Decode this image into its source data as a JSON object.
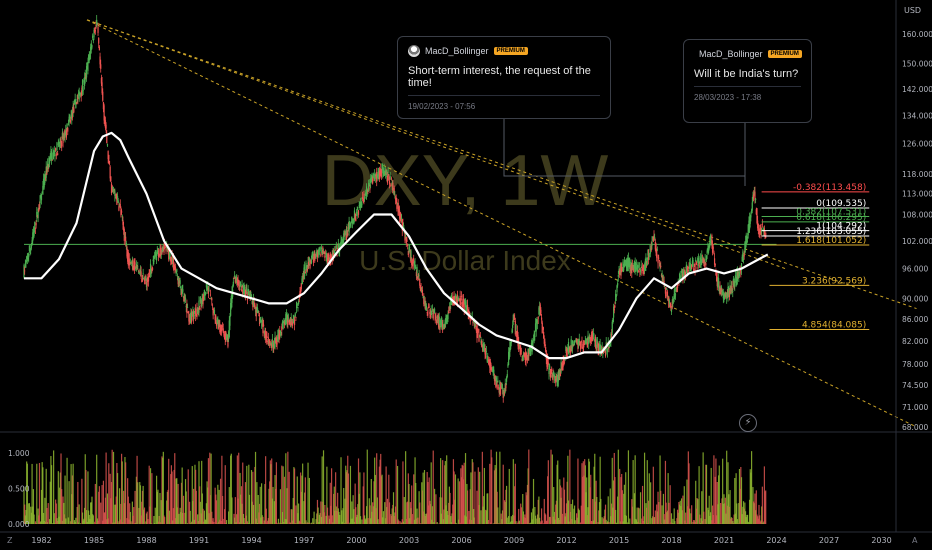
{
  "chart": {
    "watermark_title": "DXY, 1W",
    "watermark_subtitle": "U.S. Dollar Index",
    "currency_label": "USD",
    "timezone_button": "Z",
    "auto_button": "A",
    "colors": {
      "background": "#000000",
      "up": "#4caf50",
      "down": "#ef5350",
      "moving_average": "#ffffff",
      "trendline": "#c9a227",
      "fib_positive": "#ffffff",
      "fib_negative": "#ff4d4d",
      "fib_extension": "#e0b030",
      "accent_badge": "#f5a623"
    }
  },
  "annotations": [
    {
      "user": "MacD_Bollinger",
      "badge": "PREMIUM",
      "message": "Short-term interest, the request of the time!",
      "timestamp": "19/02/2023 - 07:56"
    },
    {
      "user": "MacD_Bollinger",
      "badge": "PREMIUM",
      "message": "Will it be India's turn?",
      "timestamp": "28/03/2023 - 17:38"
    }
  ],
  "chart_data": [
    {
      "type": "candlestick",
      "title": "DXY, 1W",
      "subtitle": "U.S. Dollar Index",
      "y_unit": "USD",
      "ylim": [
        66,
        166
      ],
      "xlim": [
        1981,
        2032
      ],
      "grid": false,
      "x_ticks": [
        "1982",
        "1985",
        "1988",
        "1991",
        "1994",
        "1997",
        "2000",
        "2003",
        "2006",
        "2009",
        "2012",
        "2015",
        "2018",
        "2021",
        "2024",
        "2027",
        "2030"
      ],
      "y_ticks": [
        "160.000",
        "150.000",
        "142.000",
        "134.000",
        "126.000",
        "118.000",
        "113.000",
        "108.000",
        "102.000",
        "96.000",
        "90.000",
        "86.000",
        "82.000",
        "78.000",
        "74.500",
        "71.000",
        "68.000"
      ],
      "price_path": {
        "x": [
          1981.0,
          1981.5,
          1982.0,
          1982.5,
          1983.0,
          1983.5,
          1984.0,
          1984.5,
          1985.0,
          1985.2,
          1985.5,
          1986.0,
          1986.5,
          1987.0,
          1987.5,
          1988.0,
          1988.5,
          1989.0,
          1989.5,
          1990.0,
          1990.5,
          1991.0,
          1991.5,
          1992.0,
          1992.7,
          1993.0,
          1993.5,
          1994.0,
          1994.5,
          1995.0,
          1995.3,
          1996.0,
          1996.5,
          1997.0,
          1997.5,
          1998.0,
          1998.5,
          1999.0,
          1999.5,
          2000.0,
          2000.5,
          2001.0,
          2001.5,
          2002.0,
          2002.5,
          2003.0,
          2003.5,
          2004.0,
          2004.5,
          2005.0,
          2005.5,
          2006.0,
          2006.5,
          2007.0,
          2007.5,
          2008.0,
          2008.5,
          2009.0,
          2009.5,
          2010.0,
          2010.5,
          2011.0,
          2011.5,
          2012.0,
          2012.5,
          2013.0,
          2013.5,
          2014.0,
          2014.5,
          2015.0,
          2015.5,
          2016.0,
          2016.5,
          2017.0,
          2017.5,
          2018.0,
          2018.5,
          2019.0,
          2019.5,
          2020.0,
          2020.3,
          2020.6,
          2021.0,
          2021.5,
          2022.0,
          2022.5,
          2022.75,
          2023.0,
          2023.2,
          2023.4
        ],
        "y": [
          95,
          102,
          112,
          122,
          125,
          130,
          138,
          144,
          160,
          164,
          140,
          115,
          110,
          98,
          96,
          93,
          98,
          101,
          98,
          92,
          86,
          88,
          92,
          86,
          82,
          94,
          92,
          90,
          86,
          82,
          81,
          86,
          86,
          95,
          98,
          100,
          98,
          100,
          104,
          108,
          113,
          117,
          119,
          116,
          108,
          100,
          95,
          88,
          87,
          84,
          90,
          90,
          87,
          83,
          79,
          75,
          73,
          86,
          79,
          80,
          88,
          77,
          75,
          80,
          82,
          81,
          83,
          80,
          81,
          95,
          97,
          96,
          96,
          103,
          94,
          88,
          94,
          96,
          97,
          98,
          103,
          94,
          90,
          92,
          96,
          106,
          114,
          104,
          105,
          103
        ]
      },
      "series": [
        {
          "name": "",
          "type": "moving_average",
          "color": "#ffffff",
          "x": [
            1981.0,
            1982.0,
            1983.0,
            1984.0,
            1985.0,
            1985.5,
            1986.0,
            1986.5,
            1987.0,
            1988.0,
            1989.0,
            1990.0,
            1991.0,
            1992.0,
            1993.0,
            1994.0,
            1995.0,
            1996.0,
            1997.0,
            1998.0,
            1999.0,
            2000.0,
            2001.0,
            2002.0,
            2003.0,
            2004.0,
            2005.0,
            2006.0,
            2007.0,
            2008.0,
            2009.0,
            2010.0,
            2011.0,
            2012.0,
            2013.0,
            2014.0,
            2015.0,
            2016.0,
            2017.0,
            2018.0,
            2019.0,
            2020.0,
            2021.0,
            2022.0,
            2023.0,
            2023.5
          ],
          "y": [
            94,
            94,
            98,
            106,
            124,
            128,
            129,
            127,
            122,
            113,
            102,
            96,
            94,
            92,
            91,
            90,
            89,
            89,
            91,
            95,
            100,
            104,
            108,
            108,
            103,
            96,
            91,
            88,
            85,
            83,
            82,
            81,
            79,
            79,
            80,
            80,
            84,
            90,
            94,
            92,
            95,
            96,
            95,
            96,
            98,
            99
          ]
        }
      ],
      "trendlines": [
        {
          "from": [
            1984.6,
            165
          ],
          "to": [
            2032,
            68
          ]
        },
        {
          "from": [
            1984.6,
            165
          ],
          "to": [
            2032,
            88
          ]
        },
        {
          "from": [
            1984.6,
            165
          ],
          "to": [
            2024.5,
            96
          ]
        }
      ],
      "horizontal_lines": [
        {
          "y": 101.2,
          "from_x": 1981.0,
          "to_x": 2024.0,
          "color": "#4caf50"
        }
      ],
      "fibonacci": [
        {
          "label": "-0.382(113.458)",
          "level": -0.382,
          "value": 113.458,
          "color": "#ff4d4d"
        },
        {
          "label": "0(109.535)",
          "level": 0,
          "value": 109.535,
          "color": "#ffffff"
        },
        {
          "label": "0.382(107.531)",
          "level": 0.382,
          "value": 107.531,
          "color": "#4caf50"
        },
        {
          "label": "0.618(106.295)",
          "level": 0.618,
          "value": 106.295,
          "color": "#4caf50"
        },
        {
          "label": "1(104.292)",
          "level": 1,
          "value": 104.292,
          "color": "#ffffff"
        },
        {
          "label": "1.236(103.055)",
          "level": 1.236,
          "value": 103.055,
          "color": "#ffffff"
        },
        {
          "label": "1.618(101.052)",
          "level": 1.618,
          "value": 101.052,
          "color": "#e0b030"
        },
        {
          "label": "3.236(92.569)",
          "level": 3.236,
          "value": 92.569,
          "color": "#e0b030"
        },
        {
          "label": "4.854(84.085)",
          "level": 4.854,
          "value": 84.085,
          "color": "#e0b030"
        }
      ]
    },
    {
      "type": "bar",
      "title": "",
      "series_name": "volume",
      "ylim": [
        0,
        1.1
      ],
      "y_ticks": [
        "1.000",
        "0.500",
        "0.000"
      ],
      "xlim": [
        1981,
        2032
      ],
      "note": "relative weekly volume, values 0 to 1"
    }
  ]
}
